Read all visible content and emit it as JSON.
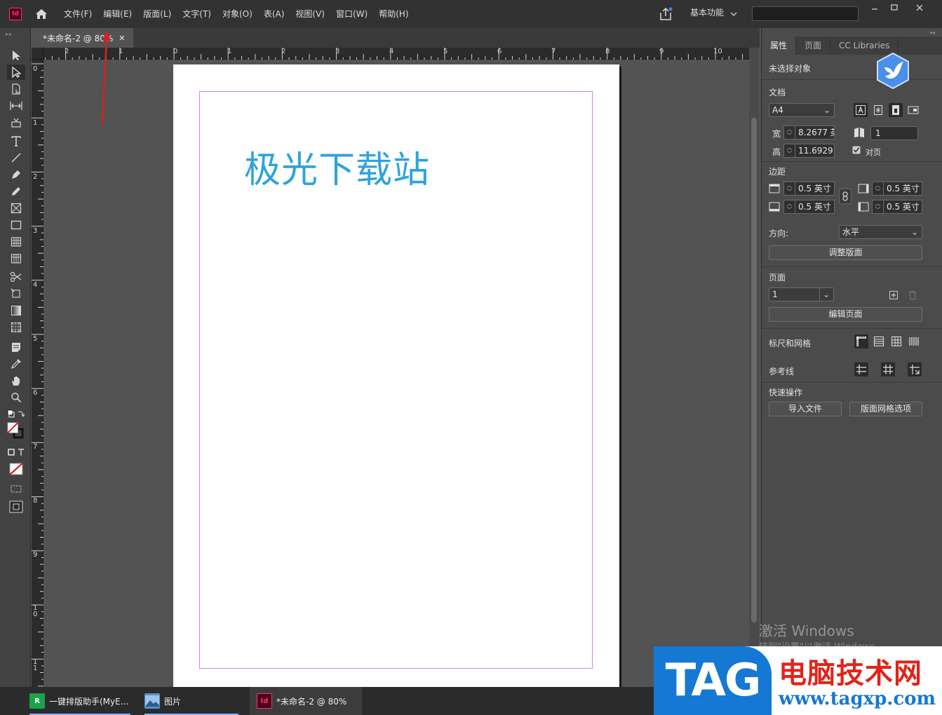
{
  "app": {
    "menu": [
      "文件(F)",
      "编辑(E)",
      "版面(L)",
      "文字(T)",
      "对象(O)",
      "表(A)",
      "视图(V)",
      "窗口(W)",
      "帮助(H)"
    ],
    "logo_text": "Id",
    "workspace": "基本功能"
  },
  "document": {
    "tab_title": "*未命名-2 @ 80%",
    "page_text": "极光下载站"
  },
  "ruler": {
    "h_labels": [
      "2",
      "1",
      "0",
      "1",
      "2",
      "3",
      "4",
      "5",
      "6",
      "7",
      "8",
      "9",
      "10"
    ],
    "v_labels": [
      "0",
      "1",
      "2",
      "3",
      "4",
      "5",
      "6",
      "7",
      "8",
      "9",
      "1 0",
      "1 1"
    ]
  },
  "panel": {
    "tabs": [
      "属性",
      "页面",
      "CC Libraries"
    ],
    "no_selection": "未选择对象",
    "document_label": "文档",
    "page_size": "A4",
    "width_label": "宽",
    "width_value": "8.2677 英",
    "height_label": "高",
    "height_value": "11.6929",
    "pages_value": "1",
    "facing_pages_label": "对页",
    "margins_label": "边距",
    "margin_top": "0.5 英寸",
    "margin_bottom": "0.5 英寸",
    "margin_inside": "0.5 英寸",
    "margin_outside": "0.5 英寸",
    "orientation_label": "方向:",
    "orientation_value": "水平",
    "adjust_layout_btn": "调整版面",
    "pages_section": "页面",
    "current_page": "1",
    "edit_page_btn": "编辑页面",
    "rulers_grids_label": "标尺和网格",
    "guides_label": "参考线",
    "quick_actions_label": "快速操作",
    "import_file_btn": "导入文件",
    "layout_grid_btn": "版面网格选项"
  },
  "watermark": {
    "line1": "激活 Windows",
    "line2": "转到\"设置\"以激活 Windows。"
  },
  "taskbar": {
    "items": [
      {
        "label": "一键排版助手(MyE..."
      },
      {
        "label": "图片"
      },
      {
        "label": "*未命名-2 @ 80%"
      }
    ]
  },
  "overlay": {
    "tag": "TAG",
    "cn": "电脑技术网",
    "url": "www.tagxp.com"
  },
  "colors": {
    "page_text": "#2ea3dc",
    "accent_id": "#ff3366",
    "margin_guide": "#c78ad6",
    "arrow": "#d91f1f"
  }
}
